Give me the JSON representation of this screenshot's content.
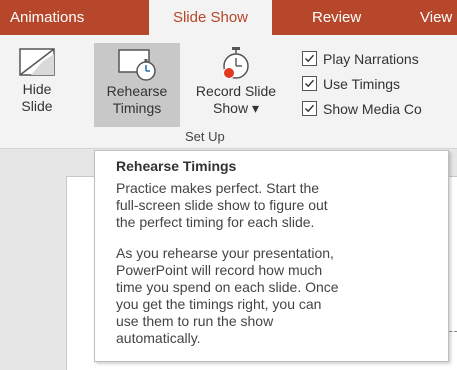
{
  "tabs": [
    {
      "label": "Animations"
    },
    {
      "label": "Slide Show"
    },
    {
      "label": "Review"
    },
    {
      "label": "View"
    }
  ],
  "ribbon": {
    "buttons": [
      {
        "line1": "Hide",
        "line2": "Slide"
      },
      {
        "line1": "Rehearse",
        "line2": "Timings"
      },
      {
        "line1": "Record Slide",
        "line2": "Show ▾"
      }
    ],
    "checkboxes": [
      {
        "label": "Play Narrations",
        "checked": true
      },
      {
        "label": "Use Timings",
        "checked": true
      },
      {
        "label": "Show Media Co",
        "checked": true
      }
    ],
    "group_label": "Set Up"
  },
  "tooltip": {
    "title": "Rehearse Timings",
    "para1": [
      "Practice makes perfect. Start the",
      "full-screen slide show to figure out",
      "the perfect timing for each slide."
    ],
    "para2": [
      "As you rehearse your presentation,",
      "PowerPoint will record how much",
      "time you spend on each slide. Once",
      "you get the timings right, you can",
      "use them to run the show",
      "automatically."
    ]
  },
  "colors": {
    "accent": "#b7472a",
    "ribbon_bg": "#f3f3f3",
    "pressed_bg": "#c8c8c8"
  },
  "icons": {
    "hide_slide": "hide-slide-icon",
    "rehearse": "stopwatch-slide-icon",
    "record": "record-stopwatch-icon",
    "check": "checkmark-icon"
  }
}
